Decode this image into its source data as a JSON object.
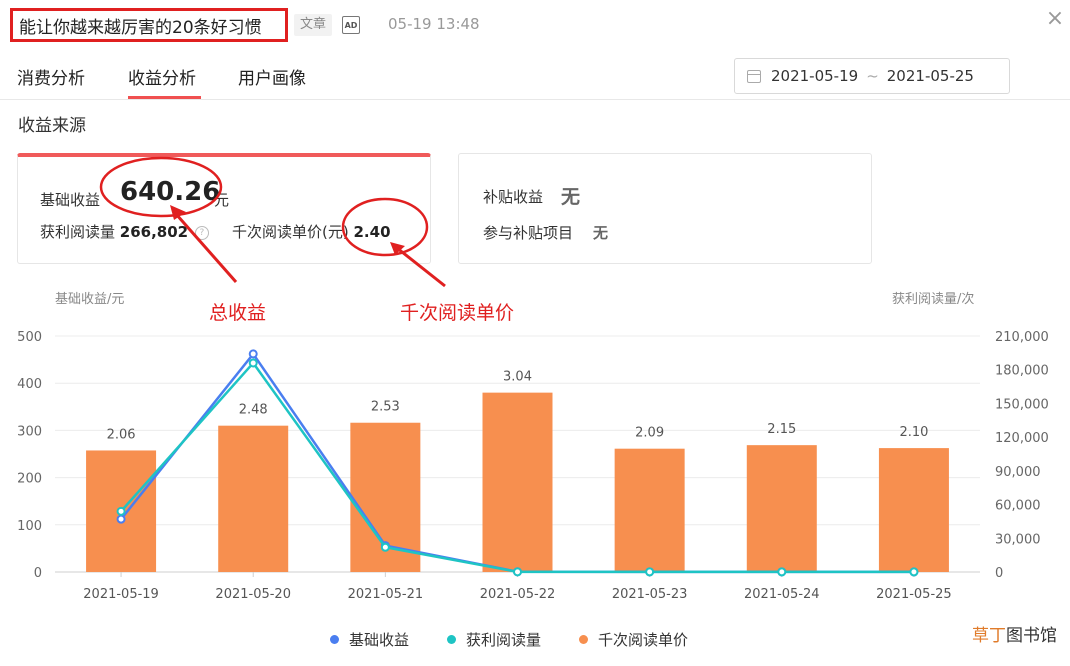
{
  "header": {
    "title": "能让你越来越厉害的20条好习惯",
    "type_tag": "文章",
    "ad_icon": "AD",
    "publish_time": "05-19 13:48",
    "close_icon": "×"
  },
  "tabs": [
    {
      "label": "消费分析",
      "active": false
    },
    {
      "label": "收益分析",
      "active": true
    },
    {
      "label": "用户画像",
      "active": false
    }
  ],
  "date_range": {
    "start": "2021-05-19",
    "separator": "~",
    "end": "2021-05-25"
  },
  "section_title": "收益来源",
  "base_card": {
    "label": "基础收益",
    "value": "640.26",
    "unit": "元",
    "reads_label": "获利阅读量",
    "reads_value": "266,802",
    "rpm_label": "千次阅读单价(元)",
    "rpm_value": "2.40"
  },
  "subsidy_card": {
    "label": "补贴收益",
    "value": "无",
    "project_label": "参与补贴项目",
    "project_value": "无"
  },
  "annotations": {
    "total_income": "总收益",
    "rpm": "千次阅读单价"
  },
  "colors": {
    "accent_red": "#e02020",
    "tab_red": "#f05050",
    "bar_orange": "#f78f4f",
    "line_blue": "#4a7ef0",
    "line_teal": "#1ec4c4"
  },
  "chart_data": {
    "type": "bar",
    "categories": [
      "2021-05-19",
      "2021-05-20",
      "2021-05-21",
      "2021-05-22",
      "2021-05-23",
      "2021-05-24",
      "2021-05-25"
    ],
    "left_axis_label": "基础收益/元",
    "right_axis_label": "获利阅读量/次",
    "left_ylim": [
      0,
      500
    ],
    "left_ticks": [
      "0",
      "100",
      "200",
      "300",
      "400",
      "500"
    ],
    "right_ylim": [
      0,
      210000
    ],
    "right_ticks": [
      "0",
      "30,000",
      "60,000",
      "90,000",
      "120,000",
      "150,000",
      "180,000",
      "210,000"
    ],
    "bar_labels": [
      "2.06",
      "2.48",
      "2.53",
      "3.04",
      "2.09",
      "2.15",
      "2.10"
    ],
    "series": [
      {
        "name": "基础收益",
        "kind": "line",
        "axis": "left",
        "values": [
          112,
          462,
          56,
          0.5,
          0.3,
          0.3,
          0.2
        ]
      },
      {
        "name": "获利阅读量",
        "kind": "line",
        "axis": "right",
        "values": [
          54000,
          186000,
          22000,
          150,
          100,
          100,
          80
        ]
      },
      {
        "name": "千次阅读单价",
        "kind": "bar",
        "axis": "left",
        "values": [
          2.06,
          2.48,
          2.53,
          3.04,
          2.09,
          2.15,
          2.1
        ]
      }
    ],
    "legend_position": "bottom",
    "grid": true
  },
  "watermark": {
    "part1": "草丁",
    "part2": "图书馆"
  }
}
